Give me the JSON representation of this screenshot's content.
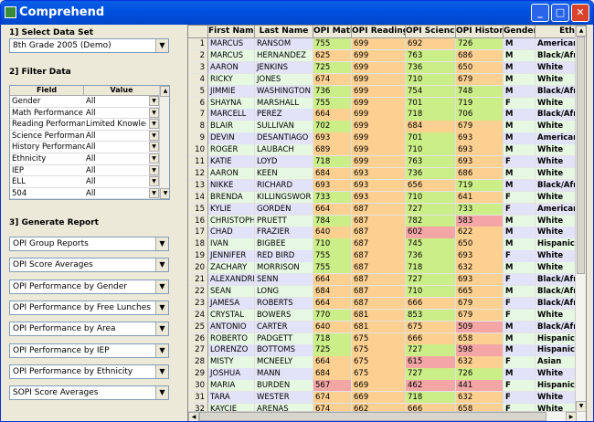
{
  "window": {
    "title": "Comprehend"
  },
  "colors": {
    "green": "#ccee88",
    "orange": "#fcd090",
    "red": "#f4a6a6",
    "lightgreen": "#e6f8e2",
    "lavender": "#e2e2f8"
  },
  "left": {
    "section1": "1] Select Data Set",
    "dataset": "8th Grade 2005 (Demo)",
    "section2": "2] Filter Data",
    "filter_headers": [
      "Field",
      "Value"
    ],
    "filters": [
      {
        "field": "Gender",
        "value": "All"
      },
      {
        "field": "Math Performance",
        "value": "All"
      },
      {
        "field": "Reading Performan",
        "value": "Limited Knowlec"
      },
      {
        "field": "Science Performan",
        "value": "All"
      },
      {
        "field": "History Performanc",
        "value": "All"
      },
      {
        "field": "Ethnicity",
        "value": "All"
      },
      {
        "field": "IEP",
        "value": "All"
      },
      {
        "field": "ELL",
        "value": "All"
      },
      {
        "field": "504",
        "value": "All"
      }
    ],
    "section3": "3] Generate Report",
    "reports": [
      "OPI Group Reports",
      "OPI Score Averages",
      "OPI Performance by Gender",
      "OPI Performance by Free Lunches",
      "OPI Performance by Area",
      "OPI Performance by IEP",
      "OPI Performance by Ethnicity",
      "SOPI Score Averages"
    ]
  },
  "table": {
    "headers": [
      "First Name",
      "Last Name",
      "OPI Math",
      "OPI Reading",
      "OPI Science",
      "OPI History",
      "Gender",
      "Eth"
    ],
    "rows": [
      [
        "1",
        "MARCUS",
        "RANSOM",
        "755",
        "699",
        "692",
        "726",
        "M",
        "American I"
      ],
      [
        "2",
        "MARCUS",
        "HERNANDEZ",
        "625",
        "699",
        "763",
        "686",
        "M",
        "Black/Afric"
      ],
      [
        "3",
        "AARON",
        "JENKINS",
        "725",
        "699",
        "736",
        "650",
        "M",
        "White"
      ],
      [
        "4",
        "RICKY",
        "JONES",
        "674",
        "699",
        "710",
        "679",
        "M",
        "White"
      ],
      [
        "5",
        "JIMMIE",
        "WASHINGTON",
        "736",
        "699",
        "754",
        "748",
        "M",
        "Black/Afric"
      ],
      [
        "6",
        "SHAYNA",
        "MARSHALL",
        "755",
        "699",
        "701",
        "719",
        "F",
        "White"
      ],
      [
        "7",
        "MARCELL",
        "PEREZ",
        "664",
        "699",
        "718",
        "706",
        "M",
        "Black/Afric"
      ],
      [
        "8",
        "BLAIR",
        "SULLIVAN",
        "702",
        "699",
        "684",
        "679",
        "M",
        "White"
      ],
      [
        "9",
        "DEVIN",
        "DESANTIAGO",
        "693",
        "699",
        "701",
        "693",
        "M",
        "American I"
      ],
      [
        "10",
        "ROGER",
        "LAUBACH",
        "689",
        "699",
        "710",
        "693",
        "M",
        "White"
      ],
      [
        "11",
        "KATIE",
        "LOYD",
        "718",
        "699",
        "763",
        "693",
        "F",
        "White"
      ],
      [
        "12",
        "AARON",
        "KEEN",
        "684",
        "693",
        "736",
        "686",
        "M",
        "White"
      ],
      [
        "13",
        "NIKKE",
        "RICHARD",
        "693",
        "693",
        "656",
        "719",
        "M",
        "Black/Afric"
      ],
      [
        "14",
        "BRENDA",
        "KILLINGSWOR",
        "733",
        "693",
        "710",
        "641",
        "F",
        "White"
      ],
      [
        "15",
        "KYLIE",
        "GORDEN",
        "664",
        "687",
        "727",
        "733",
        "F",
        "American I"
      ],
      [
        "16",
        "CHRISTOPH",
        "PRUETT",
        "784",
        "687",
        "782",
        "583",
        "M",
        "White"
      ],
      [
        "17",
        "CHAD",
        "FRAZIER",
        "640",
        "687",
        "602",
        "622",
        "M",
        "White"
      ],
      [
        "18",
        "IVAN",
        "BIGBEE",
        "710",
        "687",
        "745",
        "650",
        "M",
        "Hispanic/L"
      ],
      [
        "19",
        "JENNIFER",
        "RED BIRD",
        "755",
        "687",
        "736",
        "693",
        "F",
        "White"
      ],
      [
        "20",
        "ZACHARY",
        "MORRISON",
        "755",
        "687",
        "718",
        "632",
        "M",
        "White"
      ],
      [
        "21",
        "ALEXANDRI",
        "SENN",
        "664",
        "687",
        "727",
        "693",
        "F",
        "Black/Afric"
      ],
      [
        "22",
        "SEAN",
        "LONG",
        "684",
        "687",
        "710",
        "665",
        "M",
        "Black/Afric"
      ],
      [
        "23",
        "JAMESA",
        "ROBERTS",
        "664",
        "687",
        "666",
        "679",
        "F",
        "Black/Afric"
      ],
      [
        "24",
        "CRYSTAL",
        "BOWERS",
        "770",
        "681",
        "853",
        "679",
        "F",
        "White"
      ],
      [
        "25",
        "ANTONIO",
        "CARTER",
        "640",
        "681",
        "675",
        "509",
        "M",
        "Black/Afric"
      ],
      [
        "26",
        "ROBERTO",
        "PADGETT",
        "718",
        "675",
        "666",
        "658",
        "M",
        "Hispanic/L"
      ],
      [
        "27",
        "LORENZO",
        "BOTTOMS",
        "725",
        "675",
        "727",
        "598",
        "M",
        "Hispanic/L"
      ],
      [
        "28",
        "MISTY",
        "MCNEELY",
        "664",
        "675",
        "615",
        "632",
        "F",
        "Asian"
      ],
      [
        "29",
        "JOSHUA",
        "MANN",
        "684",
        "675",
        "727",
        "726",
        "M",
        "White"
      ],
      [
        "30",
        "MARIA",
        "BURDEN",
        "567",
        "669",
        "462",
        "441",
        "F",
        "Hispanic/L"
      ],
      [
        "31",
        "TARA",
        "WESTER",
        "674",
        "669",
        "718",
        "632",
        "F",
        "White"
      ],
      [
        "32",
        "KAYCIE",
        "ARENAS",
        "674",
        "662",
        "666",
        "658",
        "F",
        "White"
      ]
    ]
  }
}
